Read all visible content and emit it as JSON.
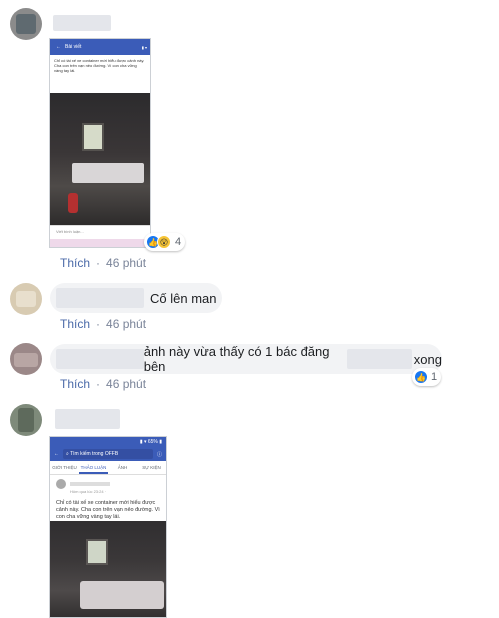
{
  "comments": [
    {
      "reply": "",
      "time": "46 phút",
      "reactions_count": "4"
    },
    {
      "reply": "Cố lên man",
      "time": "46 phút"
    },
    {
      "reply_part1": "ảnh này vừa thấy có 1 bác đăng bên",
      "reply_part2": "xong",
      "time": "46 phút",
      "reactions_count": "1"
    },
    {
      "time": ""
    }
  ],
  "like_label": "Thích",
  "separator": "·",
  "shot1": {
    "header": "Bài viết",
    "post_text": "Chỉ có tài xế xe container mới hiểu được cảnh này. Cha con trên vạn nẻo đường. Vì con cha vững vàng tay lái.",
    "reply_placeholder": "Viết bình luận..."
  },
  "shot2": {
    "search_placeholder": "Tìm kiếm trong OFFB",
    "tabs": [
      "GIỚI THIỆU",
      "THẢO LUẬN",
      "ẢNH",
      "SỰ KIỆN"
    ],
    "post_time": "Hôm qua lúc 23:24 · ",
    "post_text": "Chỉ có tài xế xe container mới hiểu được cảnh này. Cha con trên vạn nẻo đường. Vì con cha vững vàng tay lái."
  },
  "colors": {
    "link": "#4b6aa8",
    "accent": "#1877f2",
    "fb_blue": "#3b5cb8"
  },
  "icons": [
    "like-icon",
    "wow-icon",
    "back-arrow-icon",
    "search-icon",
    "info-icon"
  ]
}
